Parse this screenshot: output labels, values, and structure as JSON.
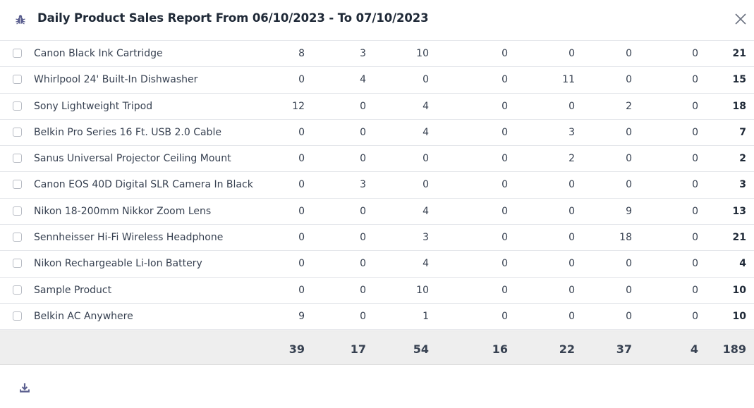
{
  "dialog": {
    "title": "Daily Product Sales Report From 06/10/2023 - To 07/10/2023",
    "icon": "bug-icon",
    "close_icon": "close-icon",
    "download_icon": "download-icon",
    "accent": "#5b5f8f"
  },
  "rows": [
    {
      "name": "Canon Black Ink Cartridge",
      "values": [
        "8",
        "3",
        "10",
        "0",
        "0",
        "0",
        "0"
      ],
      "total": "21"
    },
    {
      "name": "Whirlpool 24' Built-In Dishwasher",
      "values": [
        "0",
        "4",
        "0",
        "0",
        "11",
        "0",
        "0"
      ],
      "total": "15"
    },
    {
      "name": "Sony Lightweight Tripod",
      "values": [
        "12",
        "0",
        "4",
        "0",
        "0",
        "2",
        "0"
      ],
      "total": "18"
    },
    {
      "name": "Belkin Pro Series 16 Ft. USB 2.0 Cable",
      "values": [
        "0",
        "0",
        "4",
        "0",
        "3",
        "0",
        "0"
      ],
      "total": "7"
    },
    {
      "name": "Sanus Universal Projector Ceiling Mount",
      "values": [
        "0",
        "0",
        "0",
        "0",
        "2",
        "0",
        "0"
      ],
      "total": "2"
    },
    {
      "name": "Canon EOS 40D Digital SLR Camera In Black",
      "values": [
        "0",
        "3",
        "0",
        "0",
        "0",
        "0",
        "0"
      ],
      "total": "3"
    },
    {
      "name": "Nikon 18-200mm Nikkor Zoom Lens",
      "values": [
        "0",
        "0",
        "4",
        "0",
        "0",
        "9",
        "0"
      ],
      "total": "13"
    },
    {
      "name": "Sennheisser Hi-Fi Wireless Headphone",
      "values": [
        "0",
        "0",
        "3",
        "0",
        "0",
        "18",
        "0"
      ],
      "total": "21"
    },
    {
      "name": "Nikon Rechargeable Li-Ion Battery",
      "values": [
        "0",
        "0",
        "4",
        "0",
        "0",
        "0",
        "0"
      ],
      "total": "4"
    },
    {
      "name": "Sample Product",
      "values": [
        "0",
        "0",
        "10",
        "0",
        "0",
        "0",
        "0"
      ],
      "total": "10"
    },
    {
      "name": "Belkin AC Anywhere",
      "values": [
        "9",
        "0",
        "1",
        "0",
        "0",
        "0",
        "0"
      ],
      "total": "10"
    }
  ],
  "totals": {
    "values": [
      "39",
      "17",
      "54",
      "16",
      "22",
      "37",
      "4"
    ],
    "grand_total": "189"
  }
}
